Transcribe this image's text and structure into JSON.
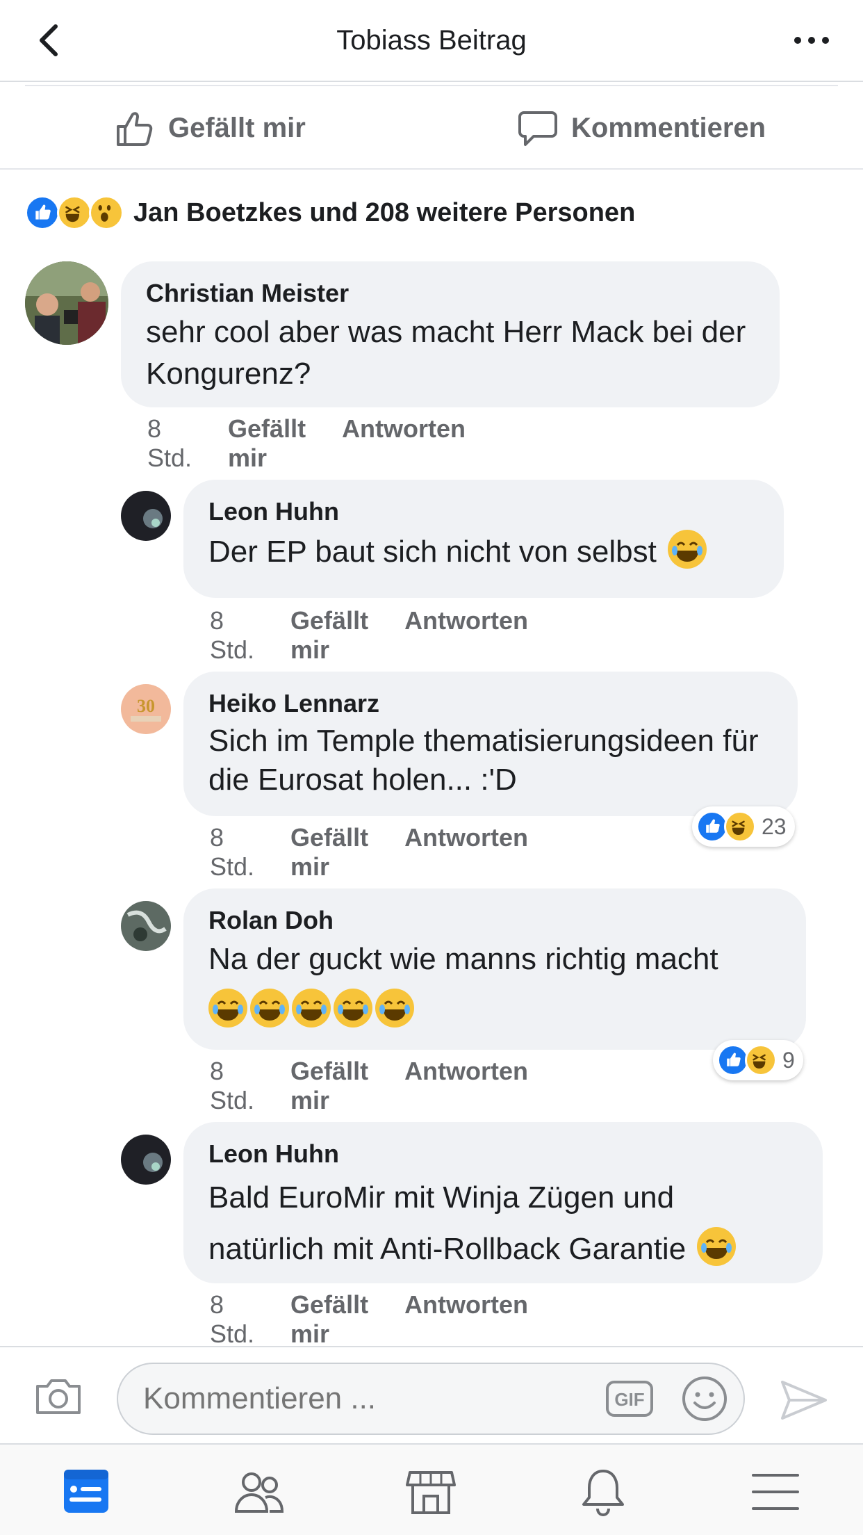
{
  "header": {
    "title": "Tobiass Beitrag"
  },
  "actions": {
    "like_label": "Gefällt mir",
    "comment_label": "Kommentieren"
  },
  "reactions_summary": {
    "text": "Jan Boetzkes und 208 weitere Personen"
  },
  "comments": [
    {
      "author": "Christian Meister",
      "text": "sehr cool aber was macht Herr Mack bei der Kongurenz?",
      "time": "8 Std.",
      "like": "Gefällt mir",
      "reply": "Antworten"
    },
    {
      "author": "Leon Huhn",
      "text": "Der EP baut sich nicht von selbst",
      "time": "8 Std.",
      "like": "Gefällt mir",
      "reply": "Antworten"
    },
    {
      "author": "Heiko Lennarz",
      "text": "Sich im Temple thematisierungsideen für die Eurosat holen... :'D",
      "time": "8 Std.",
      "like": "Gefällt mir",
      "reply": "Antworten",
      "reaction_count": "23"
    },
    {
      "author": "Rolan Doh",
      "text": "Na der guckt wie manns richtig macht",
      "time": "8 Std.",
      "like": "Gefällt mir",
      "reply": "Antworten",
      "reaction_count": "9"
    },
    {
      "author": "Leon Huhn",
      "text_line1": "Bald EuroMir mit Winja Zügen und",
      "text_line2": "natürlich mit Anti-Rollback Garantie",
      "time": "8 Std.",
      "like": "Gefällt mir",
      "reply": "Antworten"
    }
  ],
  "composer": {
    "placeholder": "Kommentieren ...",
    "gif_label": "GIF"
  },
  "colors": {
    "accent": "#1877f2",
    "bubble": "#f0f2f5",
    "muted": "#65676b",
    "emoji": "#f7c43a"
  },
  "icons": [
    "back-icon",
    "more-icon",
    "thumbs-up-icon",
    "comment-icon",
    "camera-icon",
    "gif-icon",
    "sticker-icon",
    "send-icon",
    "news-feed-icon",
    "friends-icon",
    "marketplace-icon",
    "bell-icon",
    "menu-icon"
  ]
}
